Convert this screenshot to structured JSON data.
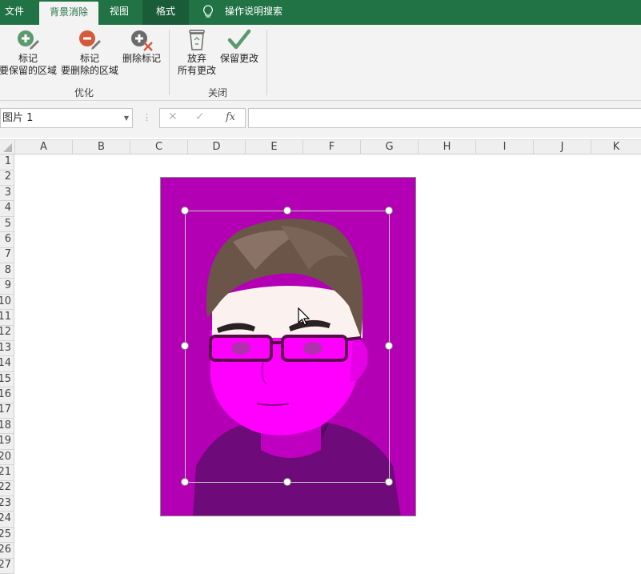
{
  "ribbon": {
    "tabs": [
      {
        "label": "文件"
      },
      {
        "label": "背景消除"
      },
      {
        "label": "视图"
      },
      {
        "label": "格式"
      },
      {
        "label": "操作说明搜索"
      }
    ],
    "buttons": {
      "mark_keep": {
        "line1": "标记",
        "line2": "要保留的区域"
      },
      "mark_remove": {
        "line1": "标记",
        "line2": "要删除的区域"
      },
      "delete_mark": {
        "line1": "删除标记"
      },
      "discard": {
        "line1": "放弃",
        "line2": "所有更改"
      },
      "keep_changes": {
        "line1": "保留更改"
      }
    },
    "groups": {
      "refine": "优化",
      "close": "关闭"
    }
  },
  "formula_bar": {
    "name_box": "图片 1",
    "fx_label": "fx",
    "cancel_glyph": "✕",
    "enter_glyph": "✓",
    "formula": ""
  },
  "sheet": {
    "columns": [
      "A",
      "B",
      "C",
      "D",
      "E",
      "F",
      "G",
      "H",
      "I",
      "J",
      "K"
    ],
    "rows": [
      "1",
      "2",
      "3",
      "4",
      "5",
      "6",
      "7",
      "8",
      "9",
      "10",
      "11",
      "12",
      "13",
      "14",
      "15",
      "16",
      "17",
      "18",
      "19",
      "20",
      "21",
      "22",
      "23",
      "24",
      "25",
      "26",
      "27"
    ]
  },
  "colors": {
    "accent": "#217346",
    "removal_overlay": "#b400b4"
  }
}
